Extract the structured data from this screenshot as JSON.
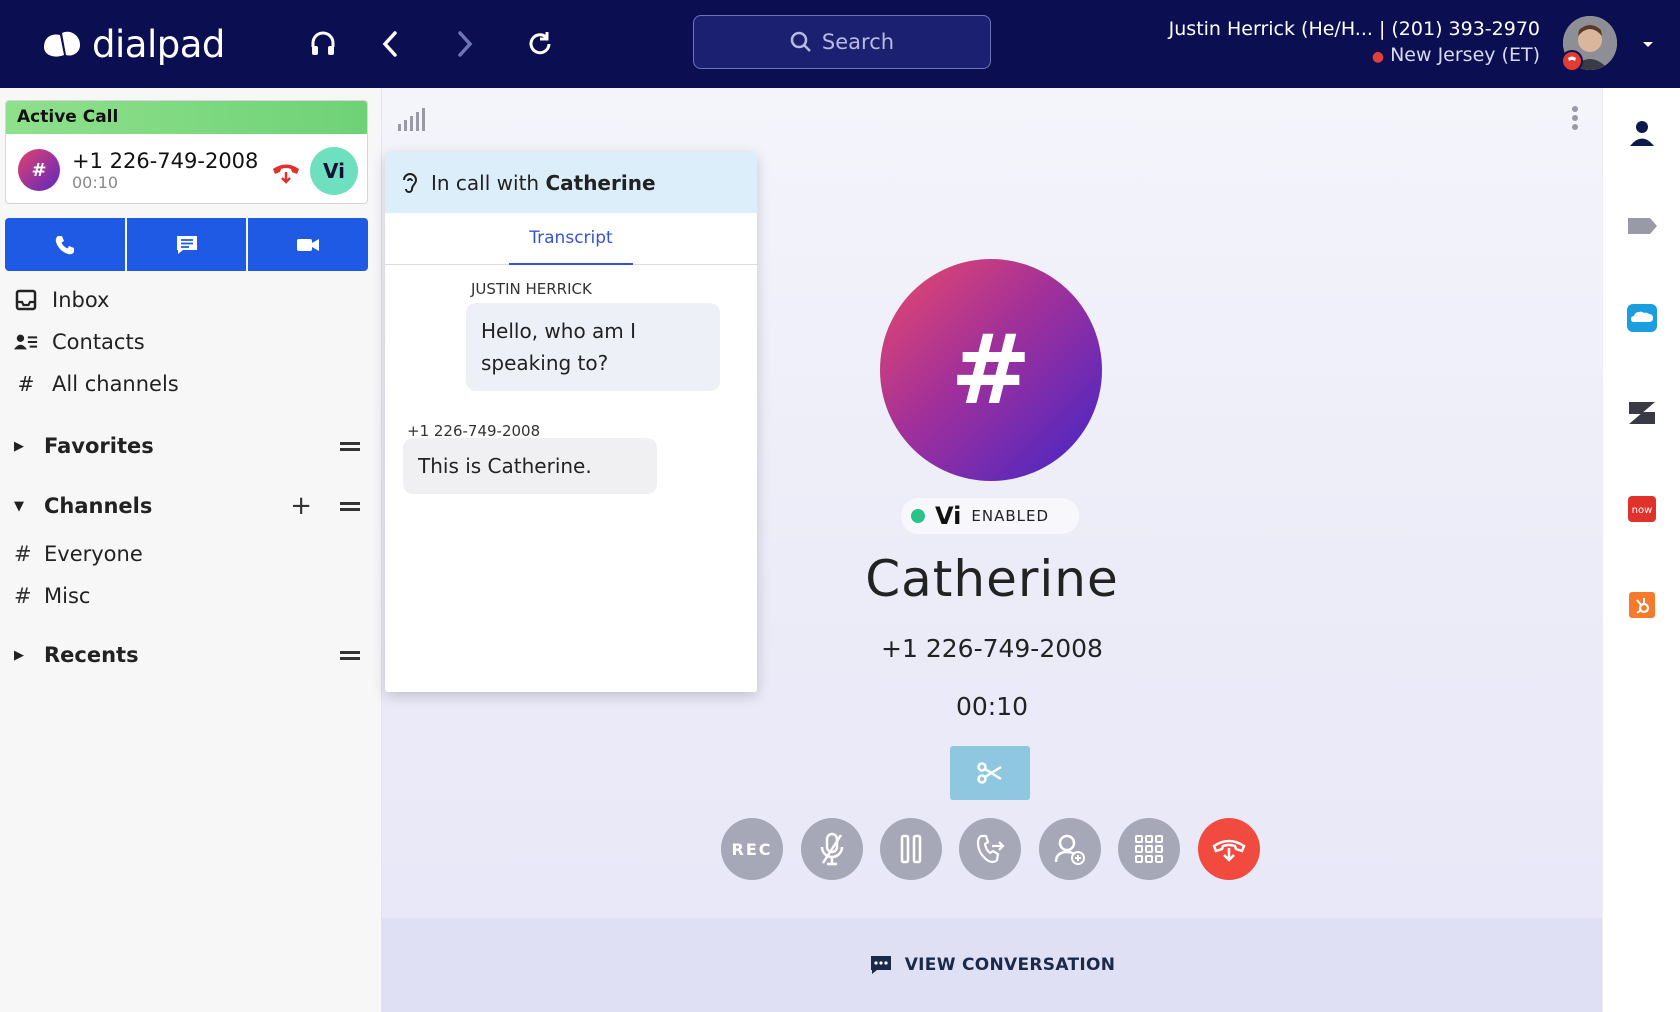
{
  "app": {
    "logo_text": "dialpad"
  },
  "search": {
    "placeholder": "Search"
  },
  "user": {
    "name": "Justin Herrick (He/H...",
    "phone": "| (201) 393-2970",
    "location": "New Jersey (ET)"
  },
  "active_call": {
    "header": "Active Call",
    "avatar_glyph": "#",
    "number": "+1 226-749-2008",
    "duration": "00:10",
    "vi_label": "Vi"
  },
  "sidebar": {
    "nav": [
      {
        "label": "Inbox",
        "icon": "inbox-icon"
      },
      {
        "label": "Contacts",
        "icon": "contacts-icon"
      },
      {
        "label": "All channels",
        "icon": "hash-icon"
      }
    ],
    "favorites_label": "Favorites",
    "channels_label": "Channels",
    "channels": [
      "Everyone",
      "Misc"
    ],
    "recents_label": "Recents"
  },
  "transcript": {
    "header_prefix": "In call with",
    "header_name": "Catherine",
    "tab": "Transcript",
    "messages": [
      {
        "speaker": "JUSTIN HERRICK",
        "text": "Hello, who am I speaking to?"
      },
      {
        "speaker": "+1 226-749-2008",
        "text": "This is Catherine."
      }
    ]
  },
  "call": {
    "avatar_glyph": "#",
    "vi_word": "Vi",
    "vi_state": "ENABLED",
    "name": "Catherine",
    "number": "+1 226-749-2008",
    "timer": "00:10",
    "rec_label": "REC",
    "view_conversation": "VIEW CONVERSATION"
  },
  "colors": {
    "topbar": "#0b0f52",
    "accent_blue": "#1f5ae4",
    "end_call": "#f04b3e",
    "active_green": "#7dd67d"
  }
}
